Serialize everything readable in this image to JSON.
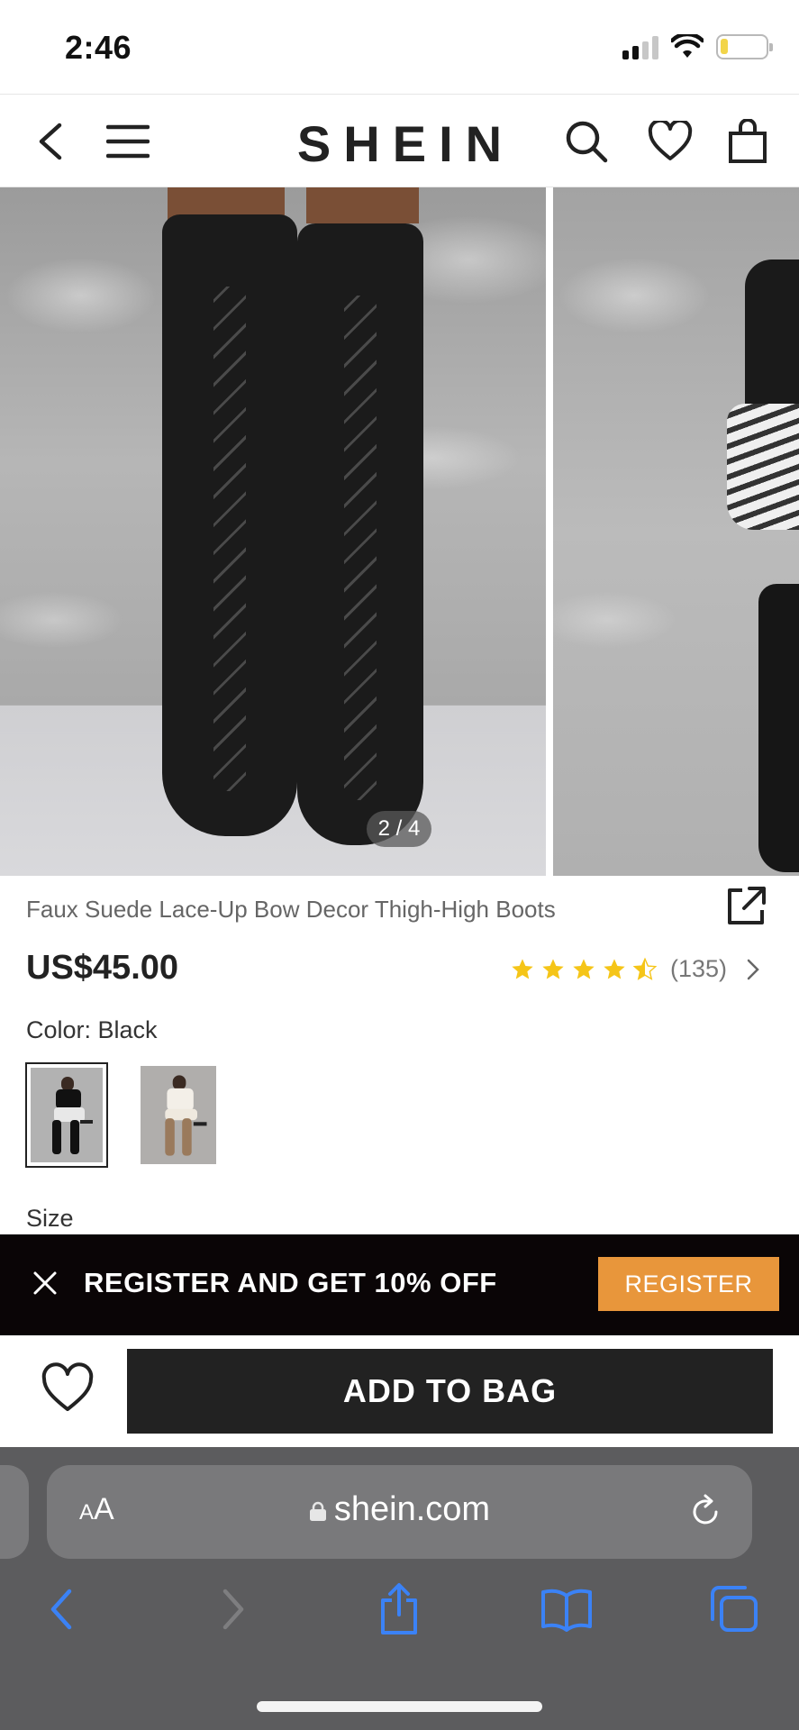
{
  "status_bar": {
    "time": "2:46"
  },
  "header": {
    "logo": "SHEIN"
  },
  "gallery": {
    "pager": "2 / 4"
  },
  "product": {
    "title": "Faux Suede Lace-Up Bow Decor Thigh-High Boots",
    "price": "US$45.00",
    "rating_stars": 4.5,
    "rating_count": "(135)",
    "color_label": "Color: Black",
    "size_label": "Size",
    "swatches": [
      "black",
      "brown"
    ]
  },
  "register_banner": {
    "text": "REGISTER AND GET 10% OFF",
    "button": "REGISTER"
  },
  "actions": {
    "add_to_bag": "ADD TO BAG"
  },
  "browser": {
    "aa_small": "A",
    "aa_large": "A",
    "url": "shein.com"
  },
  "colors": {
    "star": "#f5c518",
    "register_button": "#e8963b",
    "safari_accent": "#3b82f6"
  }
}
